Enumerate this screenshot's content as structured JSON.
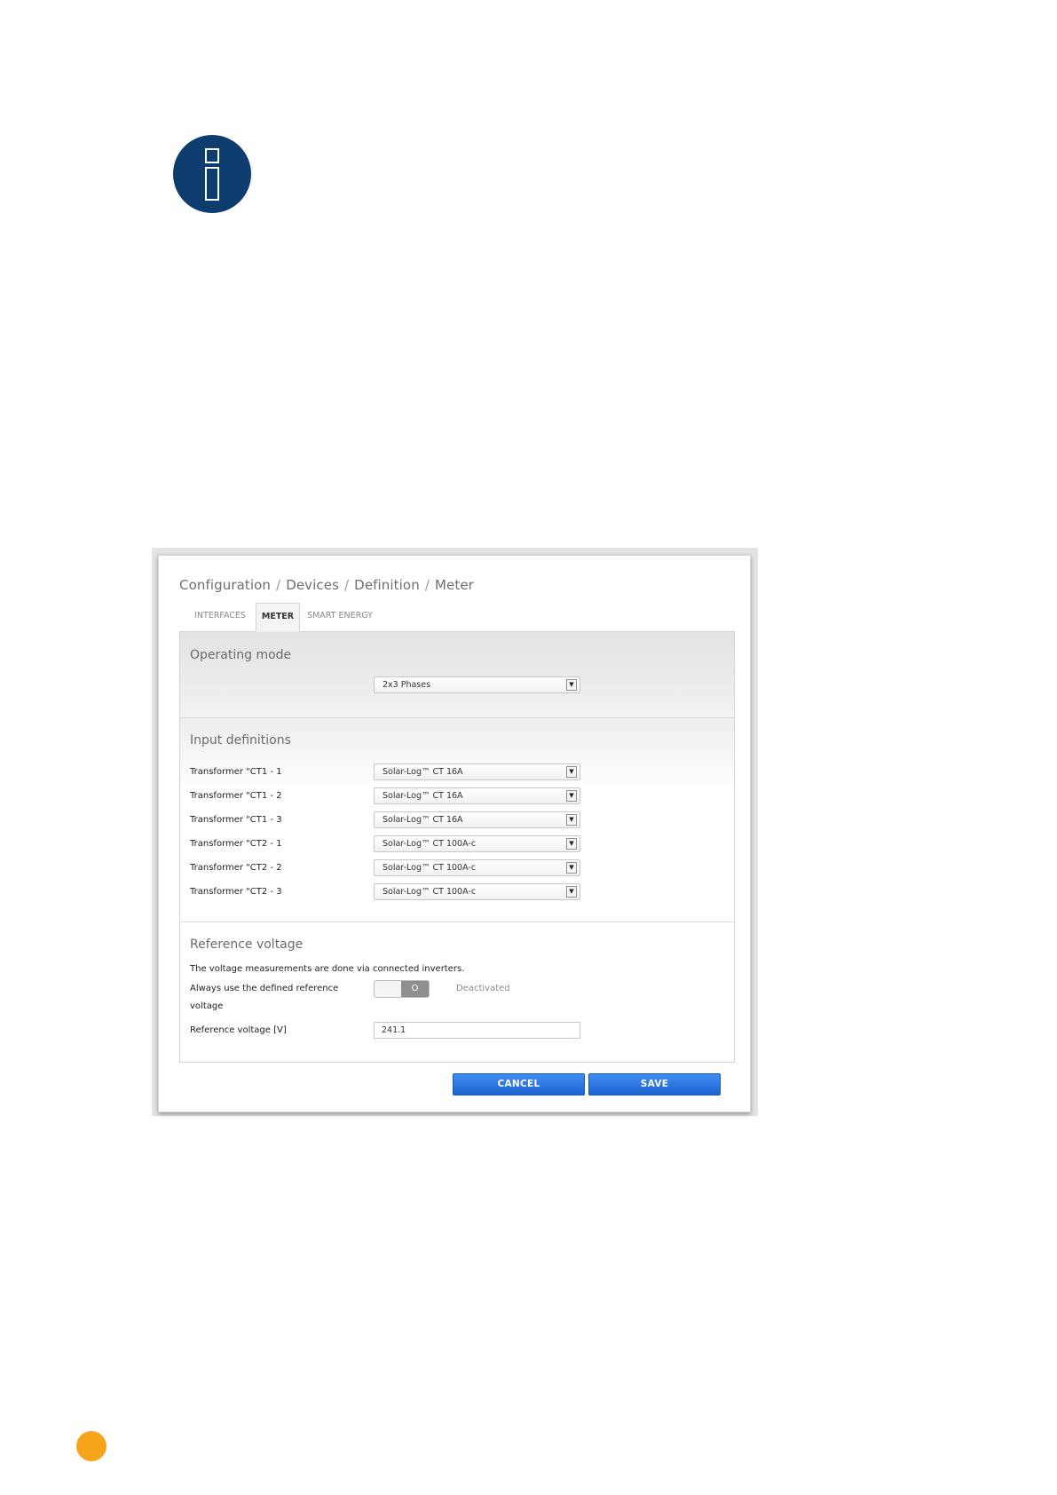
{
  "icons": {
    "info": "info-icon",
    "page_marker": "page-marker-dot"
  },
  "colors": {
    "info_icon": "#0d3c6e",
    "page_marker": "#f7a41d",
    "button": "#2f79e6"
  },
  "breadcrumb": {
    "items": [
      "Configuration",
      "Devices",
      "Definition",
      "Meter"
    ],
    "separator": "/"
  },
  "tabs": [
    {
      "label": "INTERFACES",
      "active": false
    },
    {
      "label": "METER",
      "active": true
    },
    {
      "label": "SMART ENERGY",
      "active": false
    }
  ],
  "operating_mode": {
    "title": "Operating mode",
    "value": "2x3 Phases"
  },
  "input_definitions": {
    "title": "Input definitions",
    "rows": [
      {
        "label": "Transformer \"CT1 - 1",
        "value": "Solar-Log™ CT 16A"
      },
      {
        "label": "Transformer \"CT1 - 2",
        "value": "Solar-Log™ CT 16A"
      },
      {
        "label": "Transformer \"CT1 - 3",
        "value": "Solar-Log™ CT 16A"
      },
      {
        "label": "Transformer \"CT2 - 1",
        "value": "Solar-Log™ CT 100A-c"
      },
      {
        "label": "Transformer \"CT2 - 2",
        "value": "Solar-Log™ CT 100A-c"
      },
      {
        "label": "Transformer \"CT2 - 3",
        "value": "Solar-Log™ CT 100A-c"
      }
    ]
  },
  "reference_voltage": {
    "title": "Reference voltage",
    "note": "The voltage measurements are done via connected inverters.",
    "always_label_line1": "Always use the defined reference",
    "always_label_line2": "voltage",
    "toggle_knob": "O",
    "toggle_state": "Deactivated",
    "voltage_label": "Reference voltage [V]",
    "voltage_value": "241.1"
  },
  "buttons": {
    "cancel": "CANCEL",
    "save": "SAVE"
  }
}
